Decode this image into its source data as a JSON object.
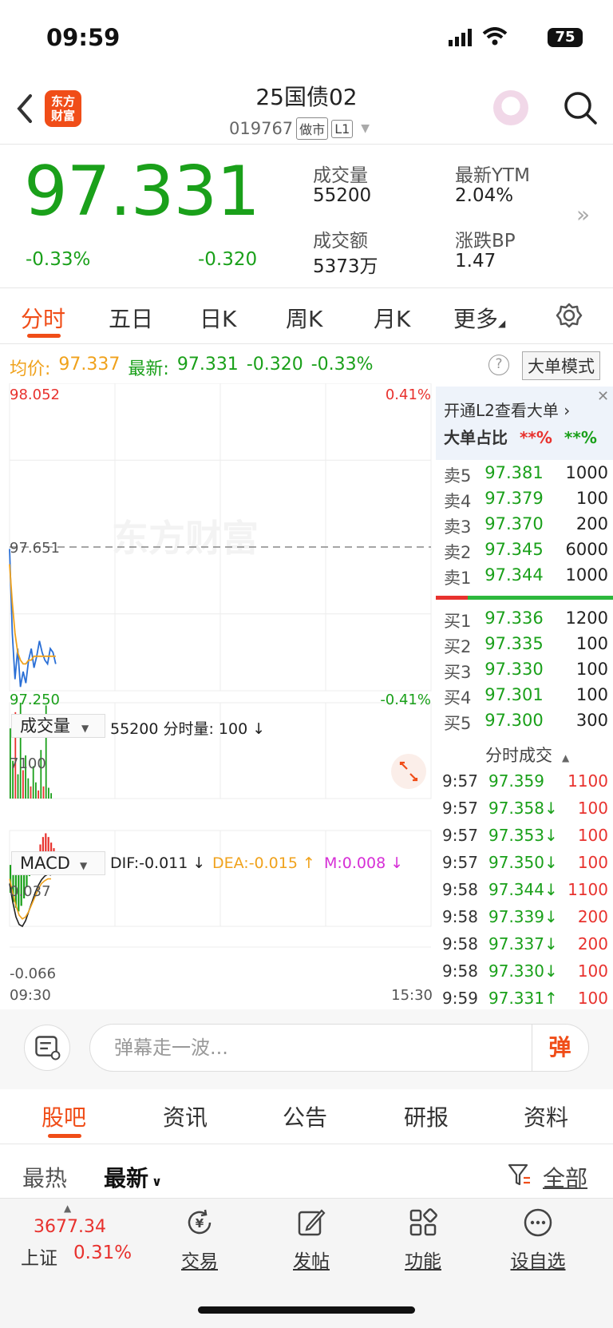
{
  "status_bar": {
    "time": "09:59",
    "battery": "75"
  },
  "header": {
    "logo_line1": "东方",
    "logo_line2": "财富",
    "stock_name": "25国债02",
    "stock_code": "019767",
    "tag_market": "做市",
    "tag_level": "L1"
  },
  "quote": {
    "price": "97.331",
    "change_pct": "-0.33%",
    "change_val": "-0.320",
    "volume_label": "成交量",
    "volume": "55200",
    "amount_label": "成交额",
    "amount": "5373万",
    "ytm_label": "最新YTM",
    "ytm": "2.04%",
    "bp_label": "涨跌BP",
    "bp": "1.47"
  },
  "chart_tabs": [
    "分时",
    "五日",
    "日K",
    "周K",
    "月K",
    "更多"
  ],
  "info_row": {
    "avg_label": "均价:",
    "avg": "97.337",
    "latest_label": "最新:",
    "latest": "97.331",
    "chg": "-0.320",
    "pct": "-0.33%",
    "big_mode": "大单模式"
  },
  "chart_labels": {
    "price_top": "98.052",
    "pct_top": "0.41%",
    "price_mid": "97.651",
    "price_low": "97.250",
    "pct_low": "-0.41%",
    "watermark": "东方财富",
    "vol_selector": "成交量",
    "vol_info": "55200 分时量: 100 ↓",
    "vol_max": "7100",
    "macd_selector": "MACD",
    "dif": "DIF:-0.011 ↓",
    "dea": "DEA:-0.015 ↑",
    "m": "M:0.008 ↓",
    "macd_top": "0.037",
    "macd_low": "-0.066",
    "time_start": "09:30",
    "time_end": "15:30"
  },
  "chart_data": {
    "type": "line",
    "x_range": [
      "09:30",
      "15:30"
    ],
    "ylim": [
      97.25,
      98.052
    ],
    "series": [
      {
        "color": "#2a6fd6",
        "values": [
          97.62,
          97.4,
          97.28,
          97.36,
          97.26,
          97.3,
          97.27,
          97.33,
          97.36,
          97.31,
          97.34,
          97.38,
          97.35,
          97.33,
          97.32,
          97.36,
          97.35,
          97.32
        ]
      },
      {
        "color": "#f0a21c",
        "values": [
          97.58,
          97.48,
          97.4,
          97.35,
          97.33,
          97.32,
          97.32,
          97.33,
          97.33,
          97.34,
          97.34,
          97.34,
          97.34,
          97.34,
          97.34,
          97.34,
          97.34,
          97.34
        ]
      }
    ],
    "volume": {
      "ymax": 7100,
      "values": [
        5200,
        2800,
        6400,
        1800,
        7100,
        2100,
        3200,
        1500,
        900,
        2400,
        1200,
        600,
        3600,
        900,
        6900,
        800,
        400
      ],
      "colors": [
        "g",
        "g",
        "r",
        "g",
        "g",
        "r",
        "g",
        "g",
        "r",
        "g",
        "g",
        "r",
        "g",
        "r",
        "g",
        "g",
        "g"
      ]
    },
    "macd": {
      "ylim": [
        -0.066,
        0.037
      ],
      "hist": [
        -0.03,
        -0.04,
        -0.046,
        -0.05,
        -0.044,
        -0.036,
        -0.024,
        -0.012,
        -0.004,
        0.006,
        0.014,
        0.022,
        0.03,
        0.034,
        0.03,
        0.024,
        0.018
      ],
      "dif": [
        -0.02,
        -0.04,
        -0.056,
        -0.064,
        -0.066,
        -0.06,
        -0.05,
        -0.04,
        -0.03,
        -0.022,
        -0.016,
        -0.012,
        -0.01,
        -0.011
      ],
      "dea": [
        -0.015,
        -0.03,
        -0.044,
        -0.054,
        -0.058,
        -0.056,
        -0.05,
        -0.042,
        -0.034,
        -0.026,
        -0.02,
        -0.017,
        -0.015,
        -0.015
      ]
    }
  },
  "order_book": {
    "l2_text": "开通L2查看大单 ›",
    "big_ratio_label": "大单占比",
    "big_buy": "**%",
    "big_sell": "**%",
    "sells": [
      {
        "label": "卖5",
        "price": "97.381",
        "vol": "1000"
      },
      {
        "label": "卖4",
        "price": "97.379",
        "vol": "100"
      },
      {
        "label": "卖3",
        "price": "97.370",
        "vol": "200"
      },
      {
        "label": "卖2",
        "price": "97.345",
        "vol": "6000"
      },
      {
        "label": "卖1",
        "price": "97.344",
        "vol": "1000"
      }
    ],
    "buys": [
      {
        "label": "买1",
        "price": "97.336",
        "vol": "1200"
      },
      {
        "label": "买2",
        "price": "97.335",
        "vol": "100"
      },
      {
        "label": "买3",
        "price": "97.330",
        "vol": "100"
      },
      {
        "label": "买4",
        "price": "97.301",
        "vol": "100"
      },
      {
        "label": "买5",
        "price": "97.300",
        "vol": "300"
      }
    ]
  },
  "ticks": {
    "title": "分时成交",
    "rows": [
      {
        "time": "9:57",
        "price": "97.359",
        "vol": "1100"
      },
      {
        "time": "9:57",
        "price": "97.358↓",
        "vol": "100"
      },
      {
        "time": "9:57",
        "price": "97.353↓",
        "vol": "100"
      },
      {
        "time": "9:57",
        "price": "97.350↓",
        "vol": "100"
      },
      {
        "time": "9:58",
        "price": "97.344↓",
        "vol": "1100"
      },
      {
        "time": "9:58",
        "price": "97.339↓",
        "vol": "200"
      },
      {
        "time": "9:58",
        "price": "97.337↓",
        "vol": "200"
      },
      {
        "time": "9:58",
        "price": "97.330↓",
        "vol": "100"
      },
      {
        "time": "9:59",
        "price": "97.331↑",
        "vol": "100"
      }
    ]
  },
  "comment": {
    "placeholder": "弹幕走一波...",
    "danmu": "弹"
  },
  "bottom_tabs": [
    "股吧",
    "资讯",
    "公告",
    "研报",
    "资料"
  ],
  "sort": {
    "hot": "最热",
    "new": "最新",
    "all": "全部"
  },
  "footer": {
    "index_value": "3677.34",
    "index_name": "上证",
    "index_pct": "0.31%",
    "buttons": [
      "交易",
      "发帖",
      "功能",
      "设自选"
    ]
  },
  "colors": {
    "brand": "#f04d18",
    "up": "#e8322e",
    "down": "#1aa01a"
  }
}
